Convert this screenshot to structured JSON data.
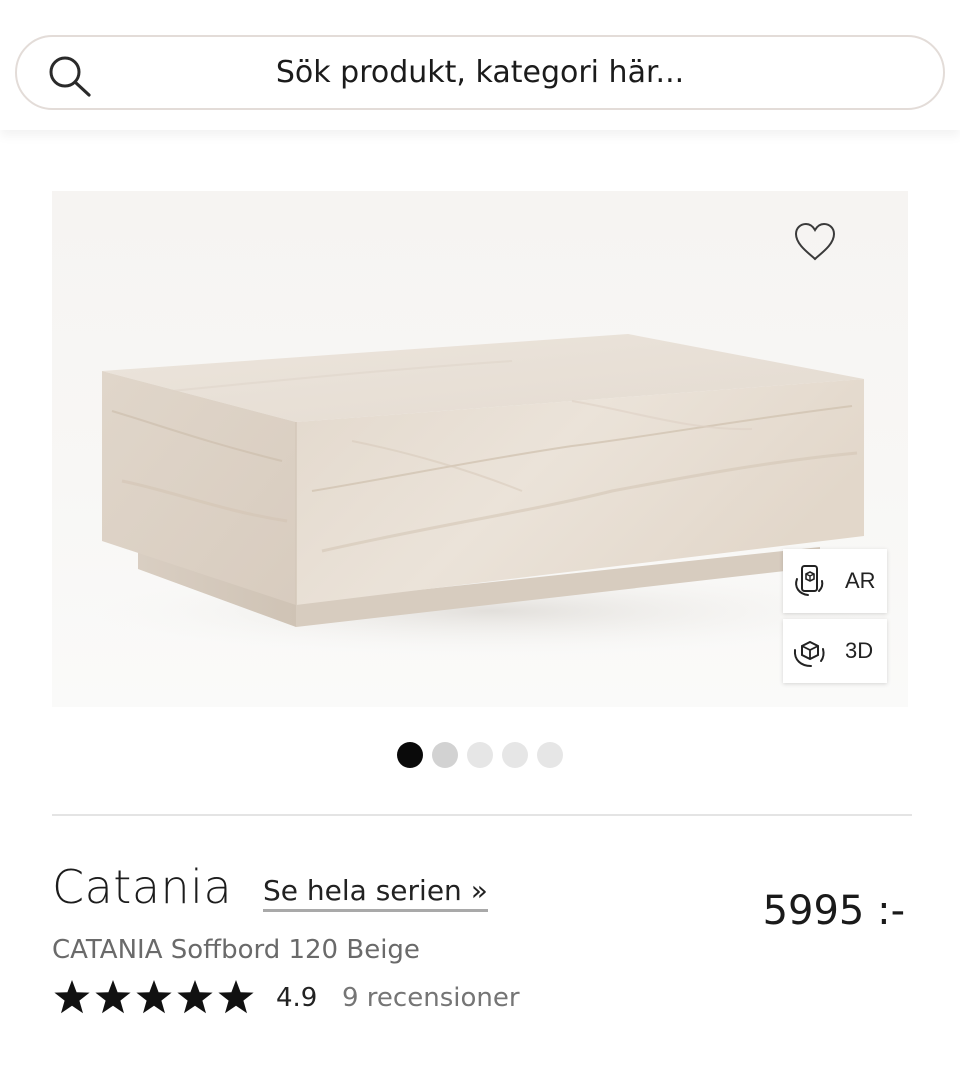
{
  "search": {
    "placeholder": "Sök produkt, kategori här...",
    "icon": "search-icon"
  },
  "product": {
    "brand": "Catania",
    "series_link": "Se hela serien »",
    "name": "CATANIA Soffbord 120 Beige",
    "price": "5995 :-",
    "rating_value": "4.9",
    "rating_stars": 5,
    "reviews_label": "9 recensioner"
  },
  "gallery": {
    "favorite_icon": "heart-outline-icon",
    "ar_label": "AR",
    "ar_icon": "ar-phone-cube-icon",
    "view3d_label": "3D",
    "view3d_icon": "cube-rotate-icon",
    "total_images": 5,
    "active_index": 0
  },
  "colors": {
    "active_dot": "#0a0a0a",
    "inactive_dot": "#d2d2d2",
    "faded_dot": "#e6e6e6",
    "star": "#111111",
    "marble": "#e7dfd6"
  }
}
